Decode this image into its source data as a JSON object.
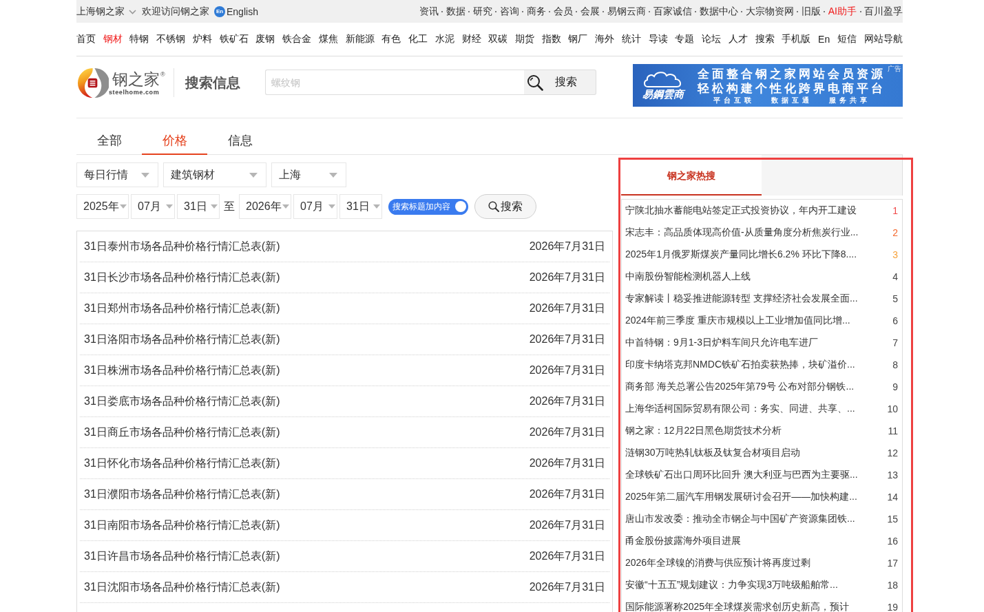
{
  "top_bar": {
    "site": "上海钢之家",
    "welcome": "欢迎访问钢之家",
    "language": {
      "badge": "En",
      "label": "English"
    },
    "links": [
      {
        "label": "资讯",
        "highlighted": false
      },
      {
        "label": "数据",
        "highlighted": false
      },
      {
        "label": "研究",
        "highlighted": false
      },
      {
        "label": "咨询",
        "highlighted": false
      },
      {
        "label": "商务",
        "highlighted": false
      },
      {
        "label": "会员",
        "highlighted": false
      },
      {
        "label": "会展",
        "highlighted": false
      },
      {
        "label": "易钢云商",
        "highlighted": false
      },
      {
        "label": "百家诚信",
        "highlighted": false
      },
      {
        "label": "数据中心",
        "highlighted": false
      },
      {
        "label": "大宗物资网",
        "highlighted": false
      },
      {
        "label": "旧版",
        "highlighted": false
      },
      {
        "label": "AI助手",
        "highlighted": true
      },
      {
        "label": "百川盈孚",
        "highlighted": false
      }
    ]
  },
  "nav": [
    {
      "label": "首页",
      "selected": false
    },
    {
      "label": "钢材",
      "selected": true
    },
    {
      "label": "特钢",
      "selected": false
    },
    {
      "label": "不锈钢",
      "selected": false
    },
    {
      "label": "炉料",
      "selected": false
    },
    {
      "label": "铁矿石",
      "selected": false
    },
    {
      "label": "废钢",
      "selected": false
    },
    {
      "label": "铁合金",
      "selected": false
    },
    {
      "label": "煤焦",
      "selected": false
    },
    {
      "label": "新能源",
      "selected": false
    },
    {
      "label": "有色",
      "selected": false
    },
    {
      "label": "化工",
      "selected": false
    },
    {
      "label": "水泥",
      "selected": false
    },
    {
      "label": "财经",
      "selected": false
    },
    {
      "label": "双碳",
      "selected": false
    },
    {
      "label": "期货",
      "selected": false
    },
    {
      "label": "指数",
      "selected": false
    },
    {
      "label": "钢厂",
      "selected": false
    },
    {
      "label": "海外",
      "selected": false
    },
    {
      "label": "统计",
      "selected": false
    },
    {
      "label": "导读",
      "selected": false
    },
    {
      "label": "专题",
      "selected": false
    },
    {
      "label": "论坛",
      "selected": false
    },
    {
      "label": "人才",
      "selected": false
    },
    {
      "label": "搜索",
      "selected": false
    },
    {
      "label": "手机版",
      "selected": false
    },
    {
      "label": "En",
      "selected": false
    },
    {
      "label": "短信",
      "selected": false
    },
    {
      "label": "网站导航",
      "selected": false
    }
  ],
  "header": {
    "logo": {
      "name": "钢之家",
      "mark": "®",
      "domain": "steelhome.com"
    },
    "section_title": "搜索信息",
    "search": {
      "placeholder": "螺纹钢",
      "button": "搜索"
    },
    "ad": {
      "logo": "易鋼雲商",
      "lines": [
        "全面整合钢之家网站会员资源",
        "轻松构建个性化跨界电商平台"
      ],
      "tags": [
        "平台互联",
        "数据互通",
        "服务共享"
      ],
      "label": "广告"
    }
  },
  "tabs": [
    {
      "label": "全部",
      "selected": false
    },
    {
      "label": "价格",
      "selected": true
    },
    {
      "label": "信息",
      "selected": false
    }
  ],
  "filters": {
    "dropdowns": [
      "每日行情",
      "建筑钢材",
      "上海"
    ],
    "date_from": [
      "2025年",
      "07月",
      "31日"
    ],
    "range_word": "至",
    "date_to": [
      "2026年",
      "07月",
      "31日"
    ],
    "toggle": {
      "label": "搜索标题加内容",
      "on": true
    },
    "search_button": "搜索"
  },
  "results": [
    {
      "title": "31日泰州市场各品种价格行情汇总表(新)",
      "date": "2026年7月31日"
    },
    {
      "title": "31日长沙市场各品种价格行情汇总表(新)",
      "date": "2026年7月31日"
    },
    {
      "title": "31日郑州市场各品种价格行情汇总表(新)",
      "date": "2026年7月31日"
    },
    {
      "title": "31日洛阳市场各品种价格行情汇总表(新)",
      "date": "2026年7月31日"
    },
    {
      "title": "31日株洲市场各品种价格行情汇总表(新)",
      "date": "2026年7月31日"
    },
    {
      "title": "31日娄底市场各品种价格行情汇总表(新)",
      "date": "2026年7月31日"
    },
    {
      "title": "31日商丘市场各品种价格行情汇总表(新)",
      "date": "2026年7月31日"
    },
    {
      "title": "31日怀化市场各品种价格行情汇总表(新)",
      "date": "2026年7月31日"
    },
    {
      "title": "31日濮阳市场各品种价格行情汇总表(新)",
      "date": "2026年7月31日"
    },
    {
      "title": "31日南阳市场各品种价格行情汇总表(新)",
      "date": "2026年7月31日"
    },
    {
      "title": "31日许昌市场各品种价格行情汇总表(新)",
      "date": "2026年7月31日"
    },
    {
      "title": "31日沈阳市场各品种价格行情汇总表(新)",
      "date": "2026年7月31日"
    }
  ],
  "hot_search": {
    "title": "钢之家热搜",
    "highlighted": true,
    "items": [
      {
        "text": "宁陕北抽水蓄能电站签定正式投资协议，年内开工建设",
        "rank": "1",
        "color": "#f04848"
      },
      {
        "text": "宋志丰：高品质体现高价值-从质量角度分析焦炭行业...",
        "rank": "2",
        "color": "#f4692f"
      },
      {
        "text": "2025年1月俄罗斯煤炭产量同比增长6.2% 环比下降8....",
        "rank": "3",
        "color": "#f6a23c"
      },
      {
        "text": "中南股份智能检测机器人上线",
        "rank": "4",
        "color": "#444444"
      },
      {
        "text": "专家解读丨稳妥推进能源转型 支撑经济社会发展全面...",
        "rank": "5",
        "color": "#444444"
      },
      {
        "text": "2024年前三季度 重庆市规模以上工业增加值同比增...",
        "rank": "6",
        "color": "#444444"
      },
      {
        "text": "中首特钢：9月1-3日炉料车间只允许电车进厂",
        "rank": "7",
        "color": "#444444"
      },
      {
        "text": "印度卡纳塔克邦NMDC铁矿石拍卖获热捧，块矿溢价...",
        "rank": "8",
        "color": "#444444"
      },
      {
        "text": "商务部 海关总署公告2025年第79号 公布对部分钢铁...",
        "rank": "9",
        "color": "#444444"
      },
      {
        "text": "上海华适柯国际贸易有限公司：务实、同进、共享、...",
        "rank": "10",
        "color": "#444444"
      },
      {
        "text": "钢之家：12月22日黑色期货技术分析",
        "rank": "11",
        "color": "#444444"
      },
      {
        "text": "涟钢30万吨热轧钛板及钛复合材项目启动",
        "rank": "12",
        "color": "#444444"
      },
      {
        "text": "全球铁矿石出口周环比回升 澳大利亚与巴西为主要驱...",
        "rank": "13",
        "color": "#444444"
      },
      {
        "text": "2025年第二届汽车用钢发展研讨会召开——加快构建...",
        "rank": "14",
        "color": "#444444"
      },
      {
        "text": "唐山市发改委：推动全市钢企与中国矿产资源集团铁...",
        "rank": "15",
        "color": "#444444"
      },
      {
        "text": "甬金股份披露海外项目进展",
        "rank": "16",
        "color": "#444444"
      },
      {
        "text": "2026年全球镍的消费与供应预计将再度过剩",
        "rank": "17",
        "color": "#444444"
      },
      {
        "text": "安徽“十五五”规划建议：力争实现3万吨级船舶常...",
        "rank": "18",
        "color": "#444444"
      },
      {
        "text": "国际能源署称2025年全球煤炭需求创历史新高，预计",
        "rank": "19",
        "color": "#444444"
      }
    ]
  }
}
